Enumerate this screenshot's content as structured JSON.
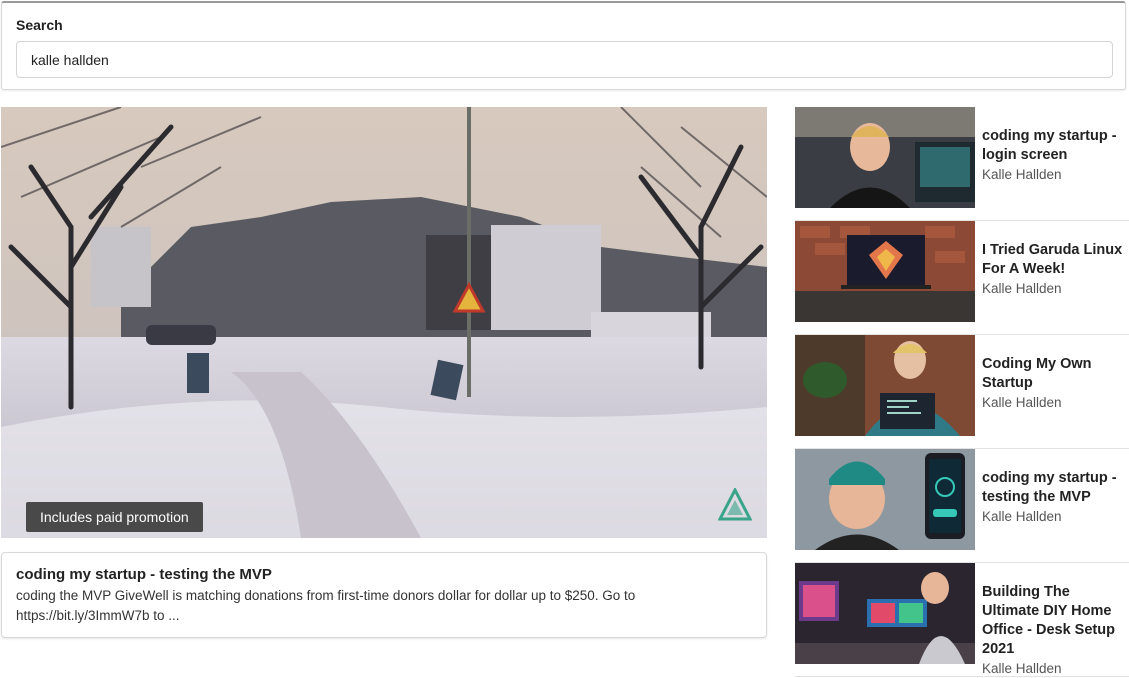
{
  "search": {
    "label": "Search",
    "value": "kalle hallden"
  },
  "player": {
    "badge": "Includes paid promotion"
  },
  "details": {
    "title": "coding my startup - testing the MVP",
    "description": "coding the MVP GiveWell is matching donations from first-time donors dollar for dollar up to $250. Go to https://bit.ly/3ImmW7b to ..."
  },
  "results": [
    {
      "title": "coding my startup - login screen",
      "channel": "Kalle Hallden"
    },
    {
      "title": "I Tried Garuda Linux For A Week!",
      "channel": "Kalle Hallden"
    },
    {
      "title": "Coding My Own Startup",
      "channel": "Kalle Hallden"
    },
    {
      "title": "coding my startup - testing the MVP",
      "channel": "Kalle Hallden"
    },
    {
      "title": "Building The Ultimate DIY Home Office - Desk Setup 2021",
      "channel": "Kalle Hallden"
    }
  ]
}
